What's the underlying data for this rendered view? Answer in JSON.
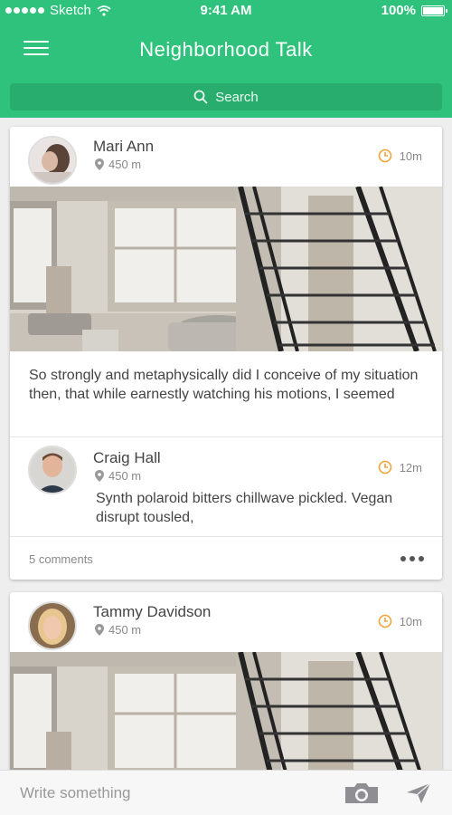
{
  "status_bar": {
    "carrier": "Sketch",
    "time": "9:41 AM",
    "battery": "100%"
  },
  "header": {
    "title": "Neighborhood Talk",
    "search_placeholder": "Search"
  },
  "posts": [
    {
      "author": "Mari Ann",
      "distance": "450 m",
      "time": "10m",
      "text": "So strongly and metaphysically did I conceive of my situation then, that while earnestly watching his motions, I seemed",
      "comment": {
        "author": "Craig Hall",
        "distance": "450 m",
        "time": "12m",
        "text": "Synth polaroid bitters chillwave pickled. Vegan disrupt tousled,"
      },
      "comments_count": "5 comments"
    },
    {
      "author": "Tammy Davidson",
      "distance": "450 m",
      "time": "10m"
    }
  ],
  "composer": {
    "placeholder": "Write something"
  },
  "colors": {
    "brand": "#2fc27c",
    "clock": "#f0a43a"
  },
  "icons": [
    "menu-icon",
    "search-icon",
    "location-pin-icon",
    "clock-icon",
    "more-icon",
    "camera-icon",
    "send-icon"
  ]
}
